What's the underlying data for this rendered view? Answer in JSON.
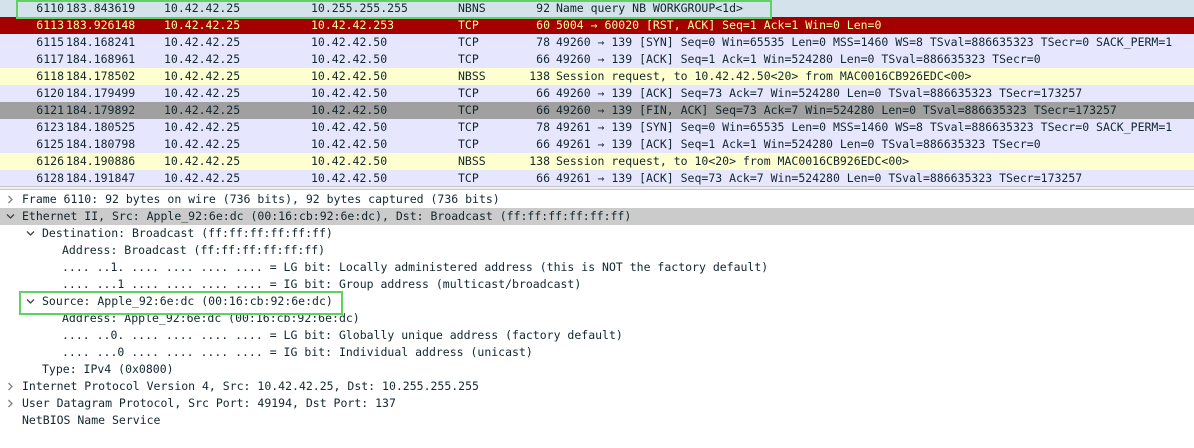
{
  "packet_list": {
    "rows": [
      {
        "no": "6110",
        "time": "183.843619",
        "src": "10.42.42.25",
        "dst": "10.255.255.255",
        "proto": "NBNS",
        "len": "92",
        "info": "Name query NB WORKGROUP<1d>",
        "scheme": "sel"
      },
      {
        "no": "6113",
        "time": "183.926148",
        "src": "10.42.42.25",
        "dst": "10.42.42.253",
        "proto": "TCP",
        "len": "60",
        "info": "5004 → 60020 [RST, ACK] Seq=1 Ack=1 Win=0 Len=0",
        "scheme": "rst"
      },
      {
        "no": "6115",
        "time": "184.168241",
        "src": "10.42.42.25",
        "dst": "10.42.42.50",
        "proto": "TCP",
        "len": "78",
        "info": "49260 → 139 [SYN] Seq=0 Win=65535 Len=0 MSS=1460 WS=8 TSval=886635323 TSecr=0 SACK_PERM=1",
        "scheme": "tcp"
      },
      {
        "no": "6117",
        "time": "184.168961",
        "src": "10.42.42.25",
        "dst": "10.42.42.50",
        "proto": "TCP",
        "len": "66",
        "info": "49260 → 139 [ACK] Seq=1 Ack=1 Win=524280 Len=0 TSval=886635323 TSecr=0",
        "scheme": "tcp"
      },
      {
        "no": "6118",
        "time": "184.178502",
        "src": "10.42.42.25",
        "dst": "10.42.42.50",
        "proto": "NBSS",
        "len": "138",
        "info": "Session request, to 10.42.42.50<20> from MAC0016CB926EDC<00>",
        "scheme": "smb"
      },
      {
        "no": "6120",
        "time": "184.179499",
        "src": "10.42.42.25",
        "dst": "10.42.42.50",
        "proto": "TCP",
        "len": "66",
        "info": "49260 → 139 [ACK] Seq=73 Ack=7 Win=524280 Len=0 TSval=886635323 TSecr=173257",
        "scheme": "tcp"
      },
      {
        "no": "6121",
        "time": "184.179892",
        "src": "10.42.42.25",
        "dst": "10.42.42.50",
        "proto": "TCP",
        "len": "66",
        "info": "49260 → 139 [FIN, ACK] Seq=73 Ack=7 Win=524280 Len=0 TSval=886635323 TSecr=173257",
        "scheme": "fin"
      },
      {
        "no": "6123",
        "time": "184.180525",
        "src": "10.42.42.25",
        "dst": "10.42.42.50",
        "proto": "TCP",
        "len": "78",
        "info": "49261 → 139 [SYN] Seq=0 Win=65535 Len=0 MSS=1460 WS=8 TSval=886635323 TSecr=0 SACK_PERM=1",
        "scheme": "tcp"
      },
      {
        "no": "6125",
        "time": "184.180798",
        "src": "10.42.42.25",
        "dst": "10.42.42.50",
        "proto": "TCP",
        "len": "66",
        "info": "49261 → 139 [ACK] Seq=1 Ack=1 Win=524280 Len=0 TSval=886635323 TSecr=0",
        "scheme": "tcp"
      },
      {
        "no": "6126",
        "time": "184.190886",
        "src": "10.42.42.25",
        "dst": "10.42.42.50",
        "proto": "NBSS",
        "len": "138",
        "info": "Session request, to 10<20> from MAC0016CB926EDC<00>",
        "scheme": "smb"
      },
      {
        "no": "6128",
        "time": "184.191847",
        "src": "10.42.42.25",
        "dst": "10.42.42.50",
        "proto": "TCP",
        "len": "66",
        "info": "49261 → 139 [ACK] Seq=73 Ack=7 Win=524280 Len=0 TSval=886635323 TSecr=173257",
        "scheme": "tcp"
      }
    ]
  },
  "details": {
    "rows": [
      {
        "arrow": "collapsed",
        "depth": 0,
        "text": "Frame 6110: 92 bytes on wire (736 bits), 92 bytes captured (736 bits)"
      },
      {
        "arrow": "expanded",
        "depth": 0,
        "text": "Ethernet II, Src: Apple_92:6e:dc (00:16:cb:92:6e:dc), Dst: Broadcast (ff:ff:ff:ff:ff:ff)",
        "selected": true
      },
      {
        "arrow": "expanded",
        "depth": 1,
        "text": "Destination: Broadcast (ff:ff:ff:ff:ff:ff)"
      },
      {
        "arrow": "none",
        "depth": 2,
        "text": "Address: Broadcast (ff:ff:ff:ff:ff:ff)"
      },
      {
        "arrow": "none",
        "depth": 2,
        "text": ".... ..1. .... .... .... .... = LG bit: Locally administered address (this is NOT the factory default)"
      },
      {
        "arrow": "none",
        "depth": 2,
        "text": ".... ...1 .... .... .... .... = IG bit: Group address (multicast/broadcast)"
      },
      {
        "arrow": "expanded",
        "depth": 1,
        "text": "Source: Apple_92:6e:dc (00:16:cb:92:6e:dc)"
      },
      {
        "arrow": "none",
        "depth": 2,
        "text": "Address: Apple_92:6e:dc (00:16:cb:92:6e:dc)"
      },
      {
        "arrow": "none",
        "depth": 2,
        "text": ".... ..0. .... .... .... .... = LG bit: Globally unique address (factory default)"
      },
      {
        "arrow": "none",
        "depth": 2,
        "text": ".... ...0 .... .... .... .... = IG bit: Individual address (unicast)"
      },
      {
        "arrow": "none",
        "depth": 1,
        "text": "Type: IPv4 (0x0800)"
      },
      {
        "arrow": "collapsed",
        "depth": 0,
        "text": "Internet Protocol Version 4, Src: 10.42.42.25, Dst: 10.255.255.255"
      },
      {
        "arrow": "collapsed",
        "depth": 0,
        "text": "User Datagram Protocol, Src Port: 49194, Dst Port: 137"
      },
      {
        "arrow": "none",
        "depth": 0,
        "text": "NetBIOS Name Service"
      }
    ]
  },
  "icons": {
    "expanded": "chevron-down-icon",
    "collapsed": "chevron-right-icon"
  },
  "colors": {
    "highlight": "#5fd35f",
    "rst_bg": "#a40000",
    "tcp_bg": "#e7e6ff",
    "nbss_bg": "#feffd0",
    "fin_bg": "#a0a0a0"
  }
}
